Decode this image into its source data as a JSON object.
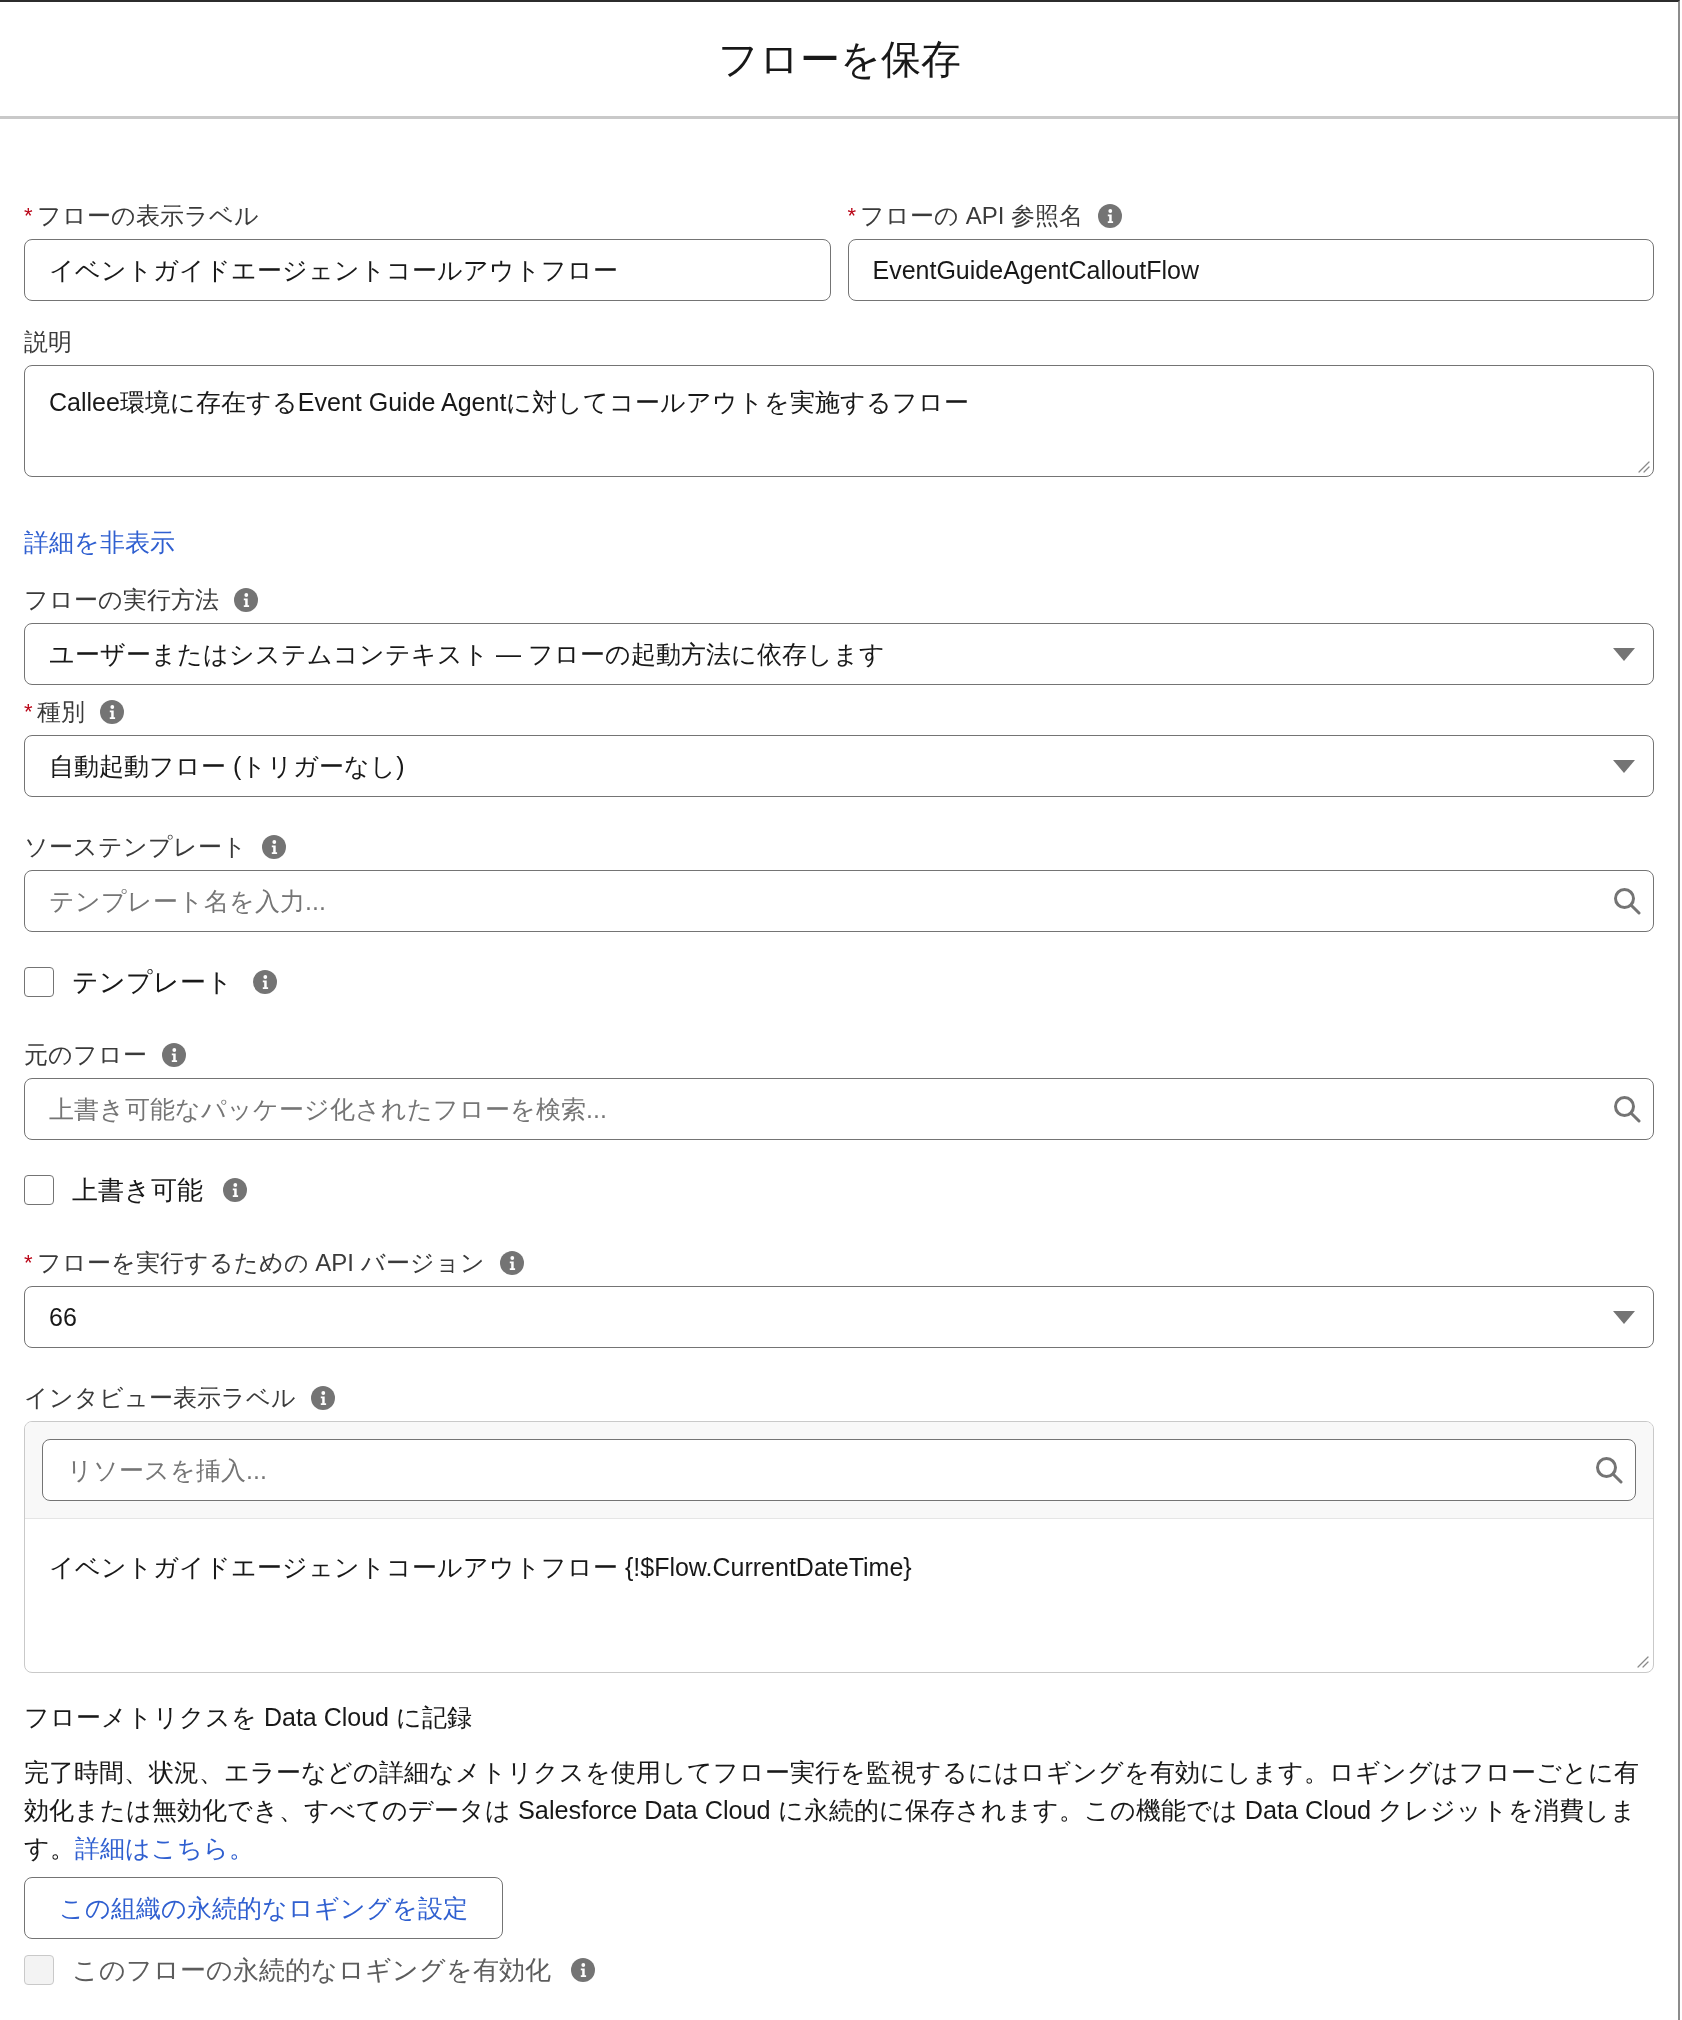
{
  "dialog": {
    "title": "フローを保存"
  },
  "name_fields": [
    {
      "required_mark": "*",
      "label": "フローの表示ラベル",
      "info": false,
      "value": "イベントガイドエージェントコールアウトフロー"
    },
    {
      "required_mark": "*",
      "label": "フローの API 参照名",
      "info": true,
      "value": "EventGuideAgentCalloutFlow"
    }
  ],
  "items": [
    {
      "kind": "textarea",
      "label": "説明",
      "info": false,
      "value": "Callee環境に存在するEvent Guide Agentに対してコールアウトを実施するフロー"
    },
    {
      "kind": "link",
      "text": "詳細を非表示"
    },
    {
      "kind": "select",
      "label": "フローの実行方法",
      "info": true,
      "value": "ユーザーまたはシステムコンテキスト — フローの起動方法に依存します"
    },
    {
      "kind": "select",
      "required_mark": "*",
      "label": "種別",
      "info": true,
      "value": "自動起動フロー (トリガーなし)"
    },
    {
      "kind": "search",
      "label": "ソーステンプレート",
      "info": true,
      "placeholder": "テンプレート名を入力..."
    },
    {
      "kind": "checkbox",
      "label": "テンプレート",
      "info": true,
      "checked": false,
      "disabled": false
    },
    {
      "kind": "search",
      "label": "元のフロー",
      "info": true,
      "placeholder": "上書き可能なパッケージ化されたフローを検索..."
    },
    {
      "kind": "checkbox",
      "label": "上書き可能",
      "info": true,
      "checked": false,
      "disabled": false
    },
    {
      "kind": "select",
      "required_mark": "*",
      "label": "フローを実行するための API バージョン",
      "info": true,
      "value": "66"
    },
    {
      "kind": "resource_text",
      "label": "インタビュー表示ラベル",
      "info": true,
      "placeholder": "リソースを挿入...",
      "value": "イベントガイドエージェントコールアウトフロー {!$Flow.CurrentDateTime}"
    },
    {
      "kind": "heading",
      "text": "フローメトリクスを Data Cloud に記録"
    },
    {
      "kind": "paragraph",
      "text": "完了時間、状況、エラーなどの詳細なメトリクスを使用してフロー実行を監視するにはロギングを有効にします。ロギングはフローごとに有効化または無効化でき、すべてのデータは Salesforce Data Cloud に永続的に保存されます。この機能では Data Cloud クレジットを消費します。",
      "link": "詳細はこちら。"
    },
    {
      "kind": "button",
      "text": "この組織の永続的なロギングを設定"
    },
    {
      "kind": "checkbox",
      "label": "このフローの永続的なロギングを有効化",
      "info": true,
      "checked": false,
      "disabled": true
    }
  ]
}
